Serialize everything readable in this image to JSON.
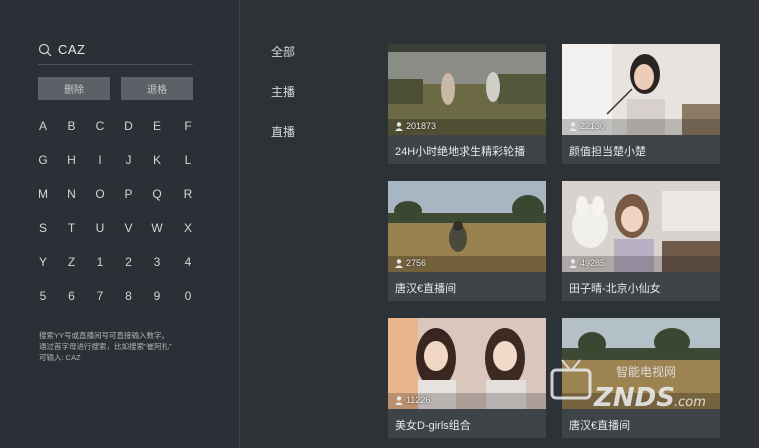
{
  "search": {
    "query": "CAZ"
  },
  "buttons": {
    "delete": "删除",
    "back": "退格"
  },
  "keyboard": {
    "rows": [
      [
        "A",
        "B",
        "C",
        "D",
        "E",
        "F"
      ],
      [
        "G",
        "H",
        "I",
        "J",
        "K",
        "L"
      ],
      [
        "M",
        "N",
        "O",
        "P",
        "Q",
        "R"
      ],
      [
        "S",
        "T",
        "U",
        "V",
        "W",
        "X"
      ],
      [
        "Y",
        "Z",
        "1",
        "2",
        "3",
        "4"
      ],
      [
        "5",
        "6",
        "7",
        "8",
        "9",
        "0"
      ]
    ]
  },
  "hint": {
    "line1": "搜索YY号或直播间号可直接输入数字。",
    "line2": "通过首字母进行搜索，比如搜索\"崔阿扎\"",
    "line3": "可输入: CAZ"
  },
  "categories": [
    "全部",
    "主播",
    "直播"
  ],
  "cards": [
    {
      "title": "24H小时绝地求生精彩轮播",
      "viewers": "201873"
    },
    {
      "title": "颜值担当楚小楚",
      "viewers": "22130"
    },
    {
      "title": "唐汉€直播间",
      "viewers": "2756"
    },
    {
      "title": "田子晴-北京小仙女",
      "viewers": "49285"
    },
    {
      "title": "美女D-girls组合",
      "viewers": "11226"
    },
    {
      "title": "唐汉€直播间",
      "viewers": ""
    }
  ],
  "watermark": {
    "top": "智能电视网",
    "bottom": "ZNDS",
    "suffix": ".com"
  }
}
